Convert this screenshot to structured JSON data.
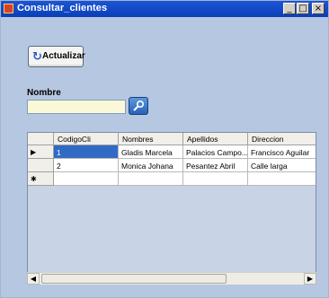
{
  "window": {
    "title": "Consultar_clientes",
    "minimize_glyph": "_",
    "maximize_glyph": "□",
    "close_glyph": "×"
  },
  "toolbar": {
    "refresh_label": "Actualizar",
    "refresh_icon": "refresh-icon"
  },
  "search": {
    "label": "Nombre",
    "value": "",
    "button_icon": "search-icon"
  },
  "grid": {
    "columns": [
      "CodigoCli",
      "Nombres",
      "Apellidos",
      "Direccion"
    ],
    "rows": [
      {
        "indicator": "▶",
        "cells": [
          "1",
          "Gladis Marcela",
          "Palacios Campo...",
          "Francisco Aguilar"
        ]
      },
      {
        "indicator": "",
        "cells": [
          "2",
          "Monica Johana",
          "Pesantez Abril",
          "Calle larga"
        ]
      },
      {
        "indicator": "✱",
        "cells": [
          "",
          "",
          "",
          ""
        ]
      }
    ],
    "selected_row": 0,
    "selected_col": 0
  },
  "scrollbar": {
    "left_arrow": "◀",
    "right_arrow": "▶"
  }
}
